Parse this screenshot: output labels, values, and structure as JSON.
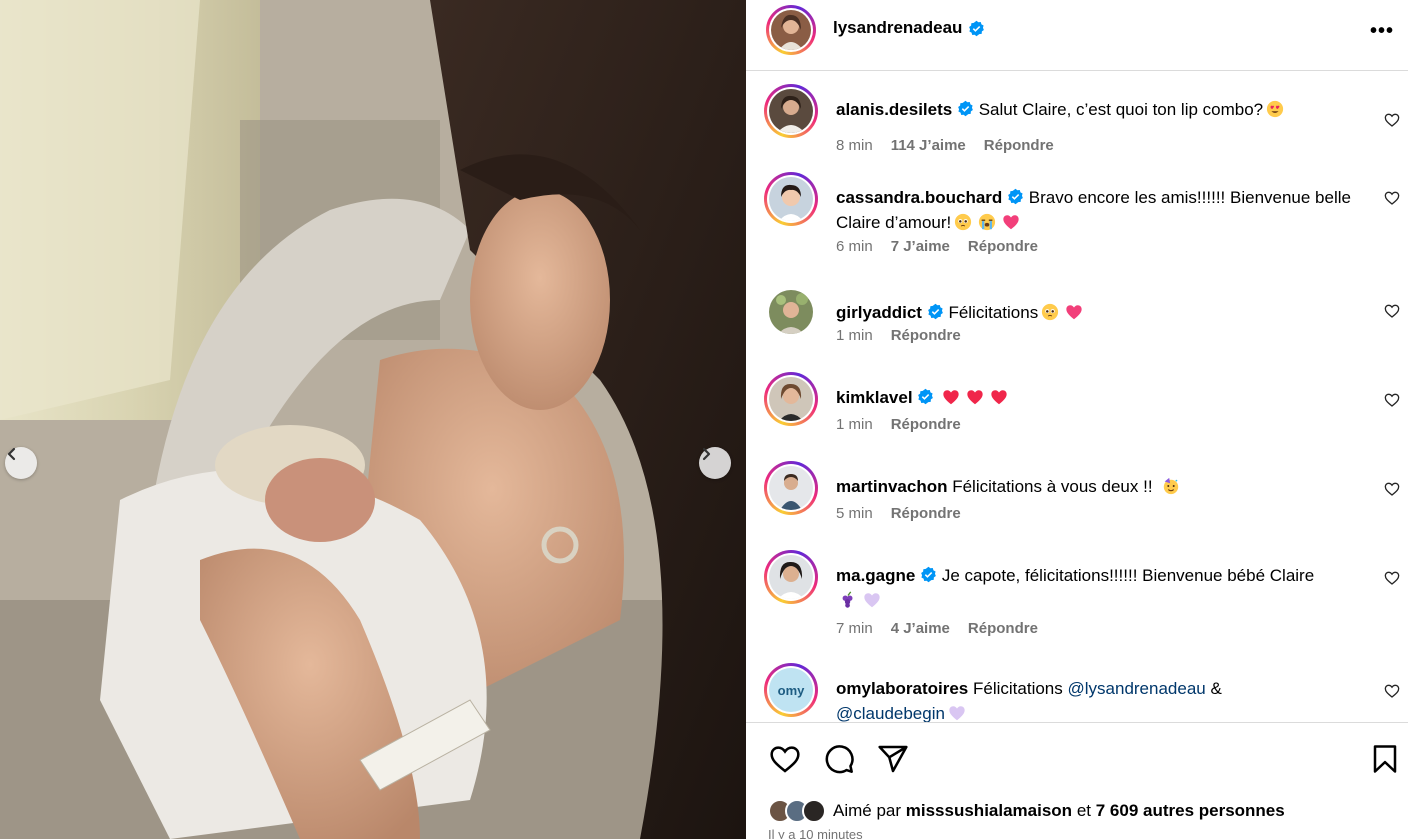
{
  "post": {
    "author": "lysandrenadeau",
    "more_label": "•••"
  },
  "comments": [
    {
      "username": "alanis.desilets",
      "verified": true,
      "text": "Salut Claire, c’est quoi ton lip combo?",
      "emojis": [
        "heart-eyes"
      ],
      "time": "8 min",
      "likes": "114 J’aime",
      "reply": "Répondre"
    },
    {
      "username": "cassandra.bouchard",
      "verified": true,
      "text": "Bravo encore les amis!!!!!! Bienvenue belle Claire d’amour!",
      "emojis": [
        "pleading",
        "crying-joy",
        "pink-heart"
      ],
      "time": "6 min",
      "likes": "7 J’aime",
      "reply": "Répondre"
    },
    {
      "username": "girlyaddict",
      "verified": true,
      "text": "Félicitations",
      "emojis": [
        "pleading",
        "pink-heart"
      ],
      "time": "1 min",
      "reply": "Répondre"
    },
    {
      "username": "kimklavel",
      "verified": true,
      "text": "",
      "emojis": [
        "red-heart",
        "red-heart",
        "red-heart"
      ],
      "time": "1 min",
      "reply": "Répondre"
    },
    {
      "username": "martinvachon",
      "verified": false,
      "text": "Félicitations à vous deux !!",
      "emojis": [
        "party-face"
      ],
      "time": "5 min",
      "reply": "Répondre"
    },
    {
      "username": "ma.gagne",
      "verified": true,
      "text": "Je capote, félicitations!!!!!! Bienvenue bébé Claire",
      "emojis": [
        "grapes",
        "lavender-heart"
      ],
      "time": "7 min",
      "likes": "4 J’aime",
      "reply": "Répondre"
    },
    {
      "username": "omylaboratoires",
      "verified": false,
      "text": "Félicitations",
      "mention1": "@lysandrenadeau",
      "connector": "&",
      "mention2": "@claudebegin",
      "emojis": [
        "lavender-heart"
      ],
      "avatar_text": "omy"
    }
  ],
  "footer": {
    "liked_by_prefix": "Aimé par",
    "liked_by_user": "misssushialamaison",
    "liked_by_connector": "et",
    "others": "7 609 autres personnes",
    "time_ago": "Il y a 10 minutes"
  },
  "colors": {
    "verified_blue": "#0095f6",
    "meta_gray": "#737373",
    "mention_blue": "#00376b",
    "border": "#dbdbdb"
  }
}
